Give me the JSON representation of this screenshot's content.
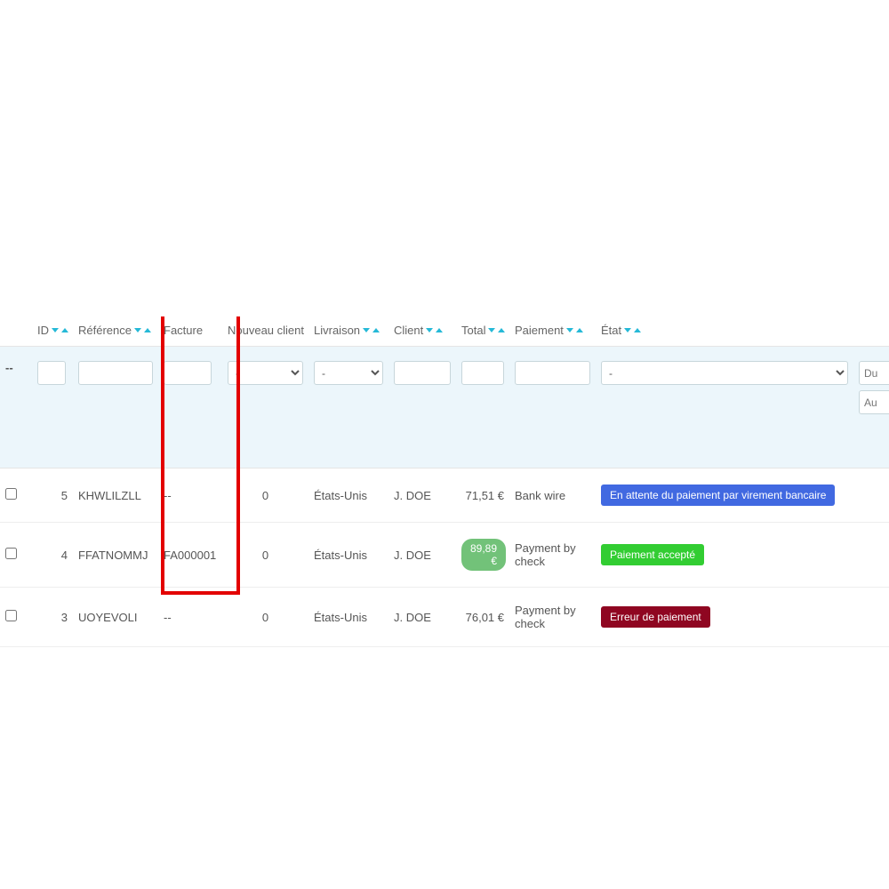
{
  "columns": {
    "id": "ID",
    "reference": "Référence",
    "facture": "Facture",
    "nouveau_client": "Nouveau client",
    "livraison": "Livraison",
    "client": "Client",
    "total": "Total",
    "paiement": "Paiement",
    "etat": "État"
  },
  "filters": {
    "chk_placeholder": "--",
    "select_dash": "-",
    "date_from_placeholder": "Du",
    "date_to_placeholder": "Au"
  },
  "rows": [
    {
      "id": "5",
      "reference": "KHWLILZLL",
      "facture": "--",
      "nouveau_client": "0",
      "livraison": "États-Unis",
      "client": "J. DOE",
      "total": "71,51 €",
      "total_highlight": false,
      "paiement": "Bank wire",
      "etat_label": "En attente du paiement par virement bancaire",
      "etat_color": "blue"
    },
    {
      "id": "4",
      "reference": "FFATNOMMJ",
      "facture": "FA000001",
      "nouveau_client": "0",
      "livraison": "États-Unis",
      "client": "J. DOE",
      "total": "89,89 €",
      "total_highlight": true,
      "paiement": "Payment by check",
      "etat_label": "Paiement accepté",
      "etat_color": "green"
    },
    {
      "id": "3",
      "reference": "UOYEVOLI",
      "facture": "--",
      "nouveau_client": "0",
      "livraison": "États-Unis",
      "client": "J. DOE",
      "total": "76,01 €",
      "total_highlight": false,
      "paiement": "Payment by check",
      "etat_label": "Erreur de paiement",
      "etat_color": "maroon"
    }
  ]
}
